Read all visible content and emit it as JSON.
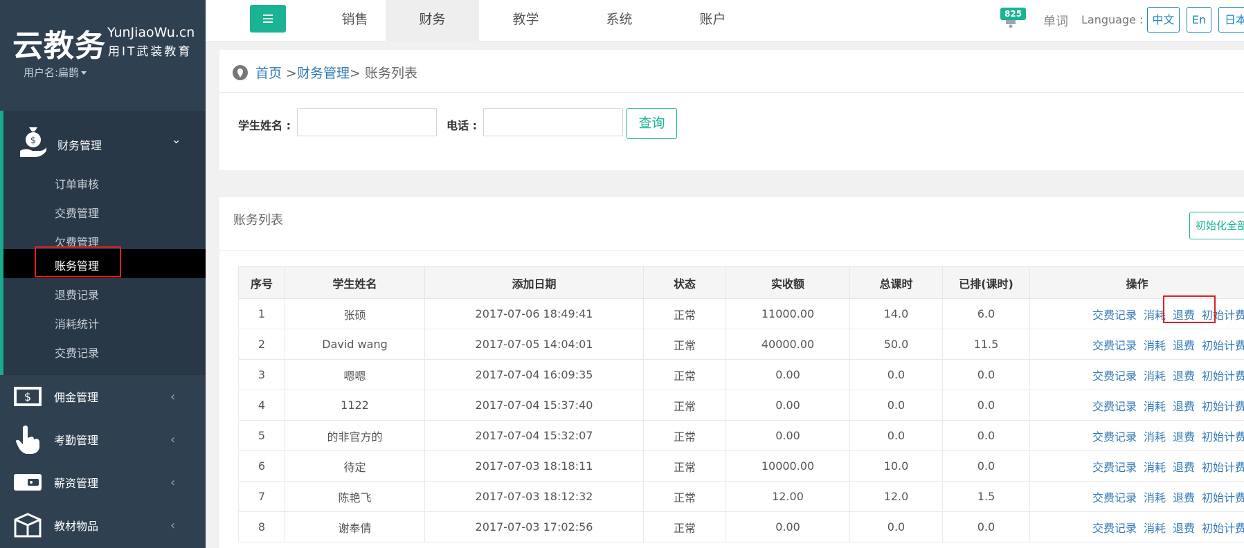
{
  "brand": {
    "name": "云教务",
    "site": "YunJiaoWu.cn",
    "slogan": "用IT武装教育"
  },
  "user": {
    "label": "用户名:扁鹊"
  },
  "sidebar": {
    "finance": {
      "label": "财务管理",
      "items": [
        {
          "label": "订单审核"
        },
        {
          "label": "交费管理"
        },
        {
          "label": "欠费管理"
        },
        {
          "label": "账务管理",
          "active": true
        },
        {
          "label": "退费记录"
        },
        {
          "label": "消耗统计"
        },
        {
          "label": "交费记录"
        }
      ]
    },
    "menus": [
      {
        "label": "佣金管理",
        "icon": "money-bag-icon"
      },
      {
        "label": "考勤管理",
        "icon": "hand-pointer-icon"
      },
      {
        "label": "薪资管理",
        "icon": "wallet-icon"
      },
      {
        "label": "教材物品",
        "icon": "box-icon"
      }
    ]
  },
  "topnav": {
    "tabs": [
      {
        "label": "销售"
      },
      {
        "label": "财务",
        "active": true
      },
      {
        "label": "教学"
      },
      {
        "label": "系统"
      },
      {
        "label": "账户"
      }
    ],
    "notification_count": "825",
    "words_label": "单词",
    "language_label": "Language :",
    "languages": [
      "中文",
      "En",
      "日本"
    ]
  },
  "breadcrumb": {
    "home": "首页",
    "sep1": " >",
    "section": "财务管理",
    "sep2": "> ",
    "current": "账务列表"
  },
  "search": {
    "student_label": "学生姓名 :",
    "student_value": "",
    "phone_label": "电话 :",
    "phone_value": "",
    "query_label": "查询"
  },
  "list": {
    "title": "账务列表",
    "init_all_label": "初始化全部",
    "columns": [
      "序号",
      "学生姓名",
      "添加日期",
      "状态",
      "实收额",
      "总课时",
      "已排(课时)",
      "操作"
    ],
    "actions": [
      "交费记录",
      "消耗",
      "退费",
      "初始计费"
    ],
    "rows": [
      {
        "no": "1",
        "name": "张硕",
        "date": "2017-07-06 18:49:41",
        "status": "正常",
        "amount": "11000.00",
        "total": "14.0",
        "scheduled": "6.0"
      },
      {
        "no": "2",
        "name": "David wang",
        "date": "2017-07-05 14:04:01",
        "status": "正常",
        "amount": "40000.00",
        "total": "50.0",
        "scheduled": "11.5"
      },
      {
        "no": "3",
        "name": "嗯嗯",
        "date": "2017-07-04 16:09:35",
        "status": "正常",
        "amount": "0.00",
        "total": "0.0",
        "scheduled": "0.0"
      },
      {
        "no": "4",
        "name": "1122",
        "date": "2017-07-04 15:37:40",
        "status": "正常",
        "amount": "0.00",
        "total": "0.0",
        "scheduled": "0.0"
      },
      {
        "no": "5",
        "name": "的非官方的",
        "date": "2017-07-04 15:32:07",
        "status": "正常",
        "amount": "0.00",
        "total": "0.0",
        "scheduled": "0.0"
      },
      {
        "no": "6",
        "name": "待定",
        "date": "2017-07-03 18:18:11",
        "status": "正常",
        "amount": "10000.00",
        "total": "10.0",
        "scheduled": "0.0"
      },
      {
        "no": "7",
        "name": "陈艳飞",
        "date": "2017-07-03 18:12:32",
        "status": "正常",
        "amount": "12.00",
        "total": "12.0",
        "scheduled": "1.5"
      },
      {
        "no": "8",
        "name": "谢奉倩",
        "date": "2017-07-03 17:02:56",
        "status": "正常",
        "amount": "0.00",
        "total": "0.0",
        "scheduled": "0.0"
      }
    ]
  },
  "colors": {
    "sidebar": "#2f4050",
    "accent": "#1ab394",
    "link": "#337ab7",
    "highlight": "#e02020"
  }
}
